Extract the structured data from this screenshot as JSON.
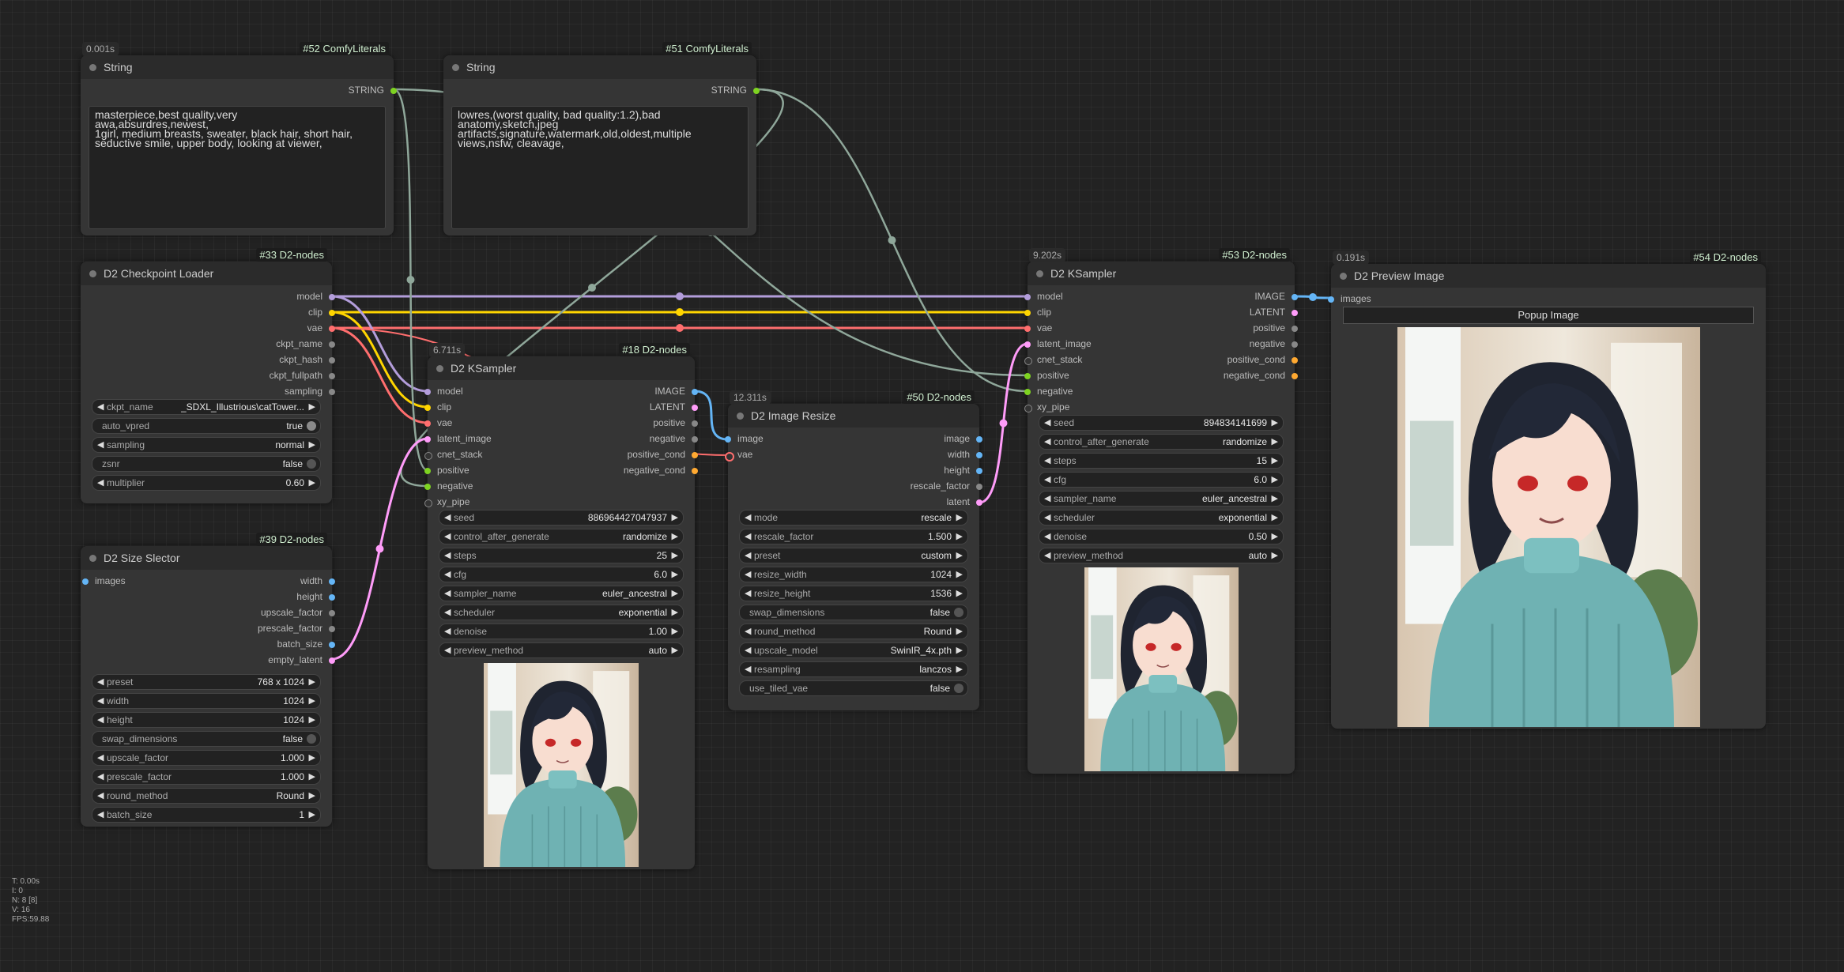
{
  "colors": {
    "model": "#b39ddb",
    "clip": "#ffd500",
    "vae": "#ff6e6e",
    "latent": "#ff9cf9",
    "image": "#64b5f6",
    "conditioning": "#ffa931",
    "string": "#7ed321",
    "generic": "#888888",
    "link_string": "#8fa79a"
  },
  "nodes": {
    "string52": {
      "badge": "#52 ComfyLiterals",
      "timing": "0.001s",
      "title": "String",
      "out": "STRING",
      "text": "masterpiece,best quality,very\nawa,absurdres,newest,\n1girl, medium breasts, sweater, black hair, short hair,\nseductive smile, upper body, looking at viewer,"
    },
    "string51": {
      "badge": "#51 ComfyLiterals",
      "title": "String",
      "out": "STRING",
      "text": "lowres,(worst quality, bad quality:1.2),bad\nanatomy,sketch,jpeg\nartifacts,signature,watermark,old,oldest,multiple\nviews,nsfw, cleavage,"
    },
    "ckpt33": {
      "badge": "#33 D2-nodes",
      "title": "D2 Checkpoint Loader",
      "outs": [
        "model",
        "clip",
        "vae",
        "ckpt_name",
        "ckpt_hash",
        "ckpt_fullpath",
        "sampling"
      ],
      "w_ckpt_label": "ckpt_name",
      "w_ckpt_value": "_SDXL_Illustrious\\catTower...",
      "w_vpred_label": "auto_vpred",
      "w_vpred_value": "true",
      "w_sampling_label": "sampling",
      "w_sampling_value": "normal",
      "w_zsnr_label": "zsnr",
      "w_zsnr_value": "false",
      "w_mult_label": "multiplier",
      "w_mult_value": "0.60"
    },
    "size39": {
      "badge": "#39 D2-nodes",
      "title": "D2 Size Slector",
      "in": "images",
      "outs": [
        "width",
        "height",
        "upscale_factor",
        "prescale_factor",
        "batch_size",
        "empty_latent"
      ],
      "widgets": [
        {
          "label": "preset",
          "value": "768 x 1024"
        },
        {
          "label": "width",
          "value": "1024"
        },
        {
          "label": "height",
          "value": "1024"
        },
        {
          "label": "swap_dimensions",
          "value": "false",
          "toggle": true
        },
        {
          "label": "upscale_factor",
          "value": "1.000"
        },
        {
          "label": "prescale_factor",
          "value": "1.000"
        },
        {
          "label": "round_method",
          "value": "Round"
        },
        {
          "label": "batch_size",
          "value": "1"
        }
      ]
    },
    "ks18": {
      "badge": "#18 D2-nodes",
      "timing": "6.711s",
      "title": "D2 KSampler",
      "ins": [
        "model",
        "clip",
        "vae",
        "latent_image",
        "cnet_stack",
        "positive",
        "negative",
        "xy_pipe"
      ],
      "outs": [
        "IMAGE",
        "LATENT",
        "positive",
        "negative",
        "positive_cond",
        "negative_cond"
      ],
      "widgets": [
        {
          "label": "seed",
          "value": "886964427047937"
        },
        {
          "label": "control_after_generate",
          "value": "randomize"
        },
        {
          "label": "steps",
          "value": "25"
        },
        {
          "label": "cfg",
          "value": "6.0"
        },
        {
          "label": "sampler_name",
          "value": "euler_ancestral"
        },
        {
          "label": "scheduler",
          "value": "exponential"
        },
        {
          "label": "denoise",
          "value": "1.00"
        },
        {
          "label": "preview_method",
          "value": "auto"
        }
      ]
    },
    "resize50": {
      "badge": "#50 D2-nodes",
      "timing": "12.311s",
      "title": "D2 Image Resize",
      "ins": [
        "image",
        "vae"
      ],
      "outs": [
        "image",
        "width",
        "height",
        "rescale_factor",
        "latent"
      ],
      "widgets": [
        {
          "label": "mode",
          "value": "rescale"
        },
        {
          "label": "rescale_factor",
          "value": "1.500"
        },
        {
          "label": "preset",
          "value": "custom"
        },
        {
          "label": "resize_width",
          "value": "1024"
        },
        {
          "label": "resize_height",
          "value": "1536"
        },
        {
          "label": "swap_dimensions",
          "value": "false",
          "toggle": true
        },
        {
          "label": "round_method",
          "value": "Round"
        },
        {
          "label": "upscale_model",
          "value": "SwinIR_4x.pth"
        },
        {
          "label": "resampling",
          "value": "lanczos"
        },
        {
          "label": "use_tiled_vae",
          "value": "false",
          "toggle": true
        }
      ]
    },
    "ks53": {
      "badge": "#53 D2-nodes",
      "timing": "9.202s",
      "title": "D2 KSampler",
      "ins": [
        "model",
        "clip",
        "vae",
        "latent_image",
        "cnet_stack",
        "positive",
        "negative",
        "xy_pipe"
      ],
      "outs": [
        "IMAGE",
        "LATENT",
        "positive",
        "negative",
        "positive_cond",
        "negative_cond"
      ],
      "widgets": [
        {
          "label": "seed",
          "value": "894834141699"
        },
        {
          "label": "control_after_generate",
          "value": "randomize"
        },
        {
          "label": "steps",
          "value": "15"
        },
        {
          "label": "cfg",
          "value": "6.0"
        },
        {
          "label": "sampler_name",
          "value": "euler_ancestral"
        },
        {
          "label": "scheduler",
          "value": "exponential"
        },
        {
          "label": "denoise",
          "value": "0.50"
        },
        {
          "label": "preview_method",
          "value": "auto"
        }
      ]
    },
    "preview54": {
      "badge": "#54 D2-nodes",
      "timing": "0.191s",
      "title": "D2 Preview Image",
      "in": "images",
      "button": "Popup Image"
    }
  },
  "stats": [
    "T: 0.00s",
    "I: 0",
    "N: 8 [8]",
    "V: 16",
    "FPS:59.88"
  ]
}
